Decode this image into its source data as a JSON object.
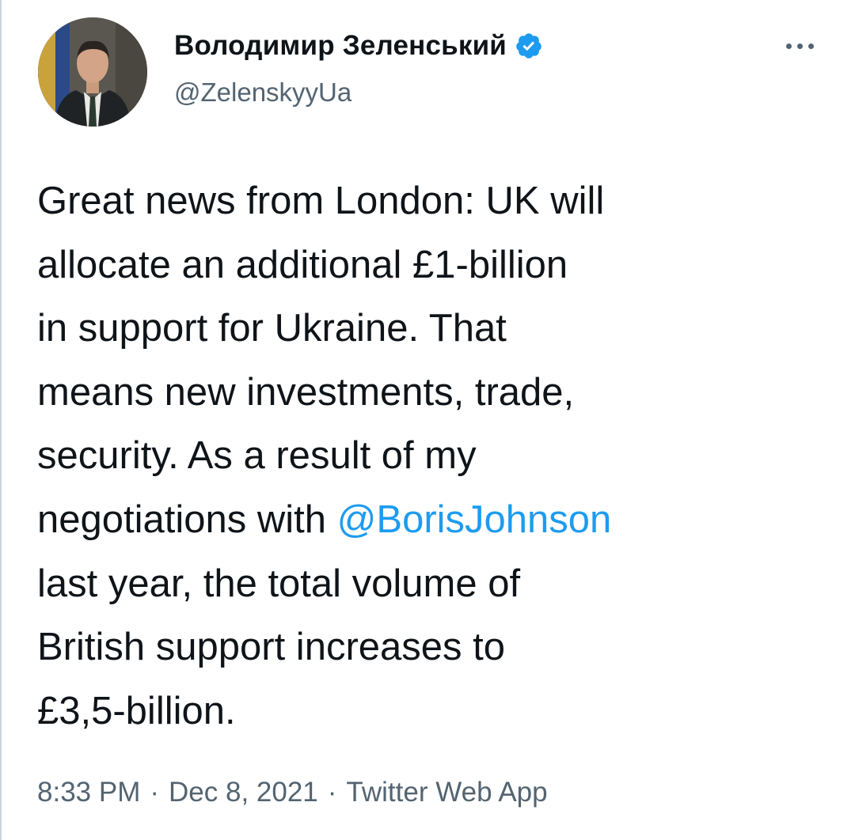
{
  "tweet": {
    "author": {
      "display_name": "Володимир Зеленський",
      "handle": "@ZelenskyyUa",
      "verified_icon": "verified-badge-icon"
    },
    "more_icon": "more-options-icon",
    "text_lines": [
      "Great news from London: UK will",
      "allocate an additional £1-billion",
      "in support for Ukraine. That",
      "means new investments, trade,",
      "security. As a result of my",
      "negotiations with ",
      "last year, the total volume of",
      "British support increases to",
      "£3,5-billion."
    ],
    "mention": "@BorisJohnson",
    "time": "8:33 PM",
    "date": "Dec 8, 2021",
    "separator": "·",
    "source": "Twitter Web App"
  },
  "colors": {
    "text": "#0f1419",
    "secondary": "#536471",
    "link": "#1d9bf0",
    "verified": "#1d9bf0"
  }
}
